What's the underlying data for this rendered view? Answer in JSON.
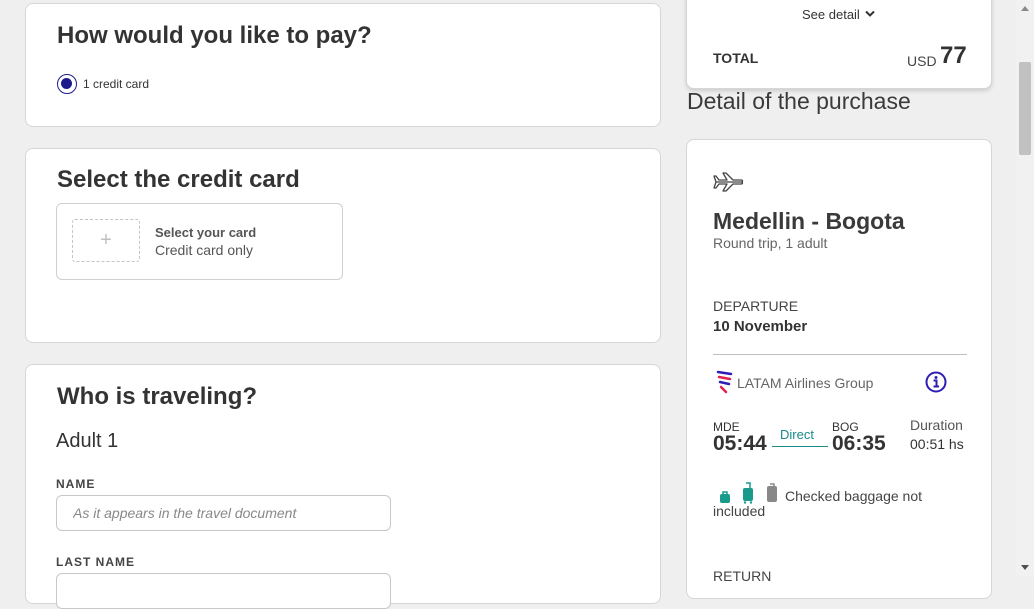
{
  "payment": {
    "title": "How would you like to pay?",
    "option_label": "1 credit card"
  },
  "credit_card": {
    "title": "Select the credit card",
    "slot_plus": "+",
    "select_label": "Select your card",
    "select_sub": "Credit card only"
  },
  "traveler": {
    "title": "Who is traveling?",
    "adult_label": "Adult 1",
    "name_label": "NAME",
    "name_placeholder": "As it appears in the travel document",
    "last_name_label": "LAST NAME"
  },
  "summary": {
    "see_detail": "See detail",
    "total_label": "TOTAL",
    "currency": "USD",
    "amount": "77"
  },
  "purchase": {
    "heading": "Detail of the purchase",
    "route": "Medellin - Bogota",
    "trip_info": "Round trip, 1 adult",
    "departure_label": "DEPARTURE",
    "departure_date": "10 November",
    "airline": "LATAM Airlines Group",
    "origin_code": "MDE",
    "origin_time": "05:44",
    "stop_type": "Direct",
    "dest_code": "BOG",
    "dest_time": "06:35",
    "duration_label": "Duration",
    "duration_value": "00:51 hs",
    "baggage_text": "Checked baggage not included",
    "return_label": "RETURN"
  },
  "colors": {
    "accent": "#1e1b8f",
    "teal": "#1a8a8a",
    "info": "#2d1fb5"
  },
  "icons": [
    "airplane-icon",
    "chevron-down-icon",
    "latam-logo-icon",
    "info-icon",
    "personal-item-icon",
    "carry-on-icon",
    "checked-baggage-icon"
  ]
}
